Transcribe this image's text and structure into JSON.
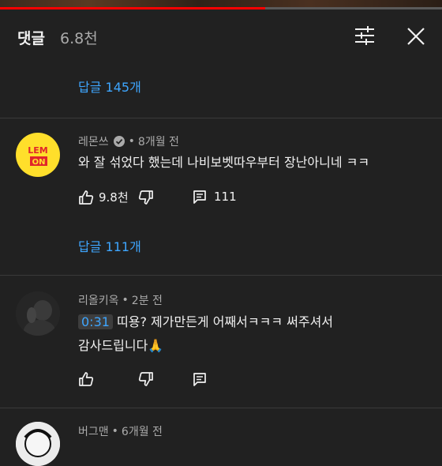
{
  "video": {
    "progress": 0.6
  },
  "header": {
    "title": "댓글",
    "count": "6.8천"
  },
  "comments": [
    {
      "replies_label": "답글 145개"
    },
    {
      "author": "레몬쓰",
      "verified": true,
      "time": "8개월 전",
      "avatar_text_top": "LEM",
      "avatar_text_bottom": "ON",
      "text": "와 잘 섞었다 했는데 나비보벳따우부터 장난아니네 ㅋㅋ",
      "likes": "9.8천",
      "reply_count": "111",
      "replies_label": "답글 111개"
    },
    {
      "author": "리올키옥",
      "time": "2분 전",
      "timestamp": "0:31",
      "text_line1": "띠용? 제가만든게 어째서ㅋㅋㅋ 써주셔서",
      "text_line2": "감사드립니다🙏"
    },
    {
      "author": "버그맨",
      "time": "6개월 전"
    }
  ],
  "separator": "•",
  "colors": {
    "accent": "#3ea6ff",
    "background": "#212121",
    "secondary_text": "#aaaaaa",
    "progress": "#ff0000"
  }
}
